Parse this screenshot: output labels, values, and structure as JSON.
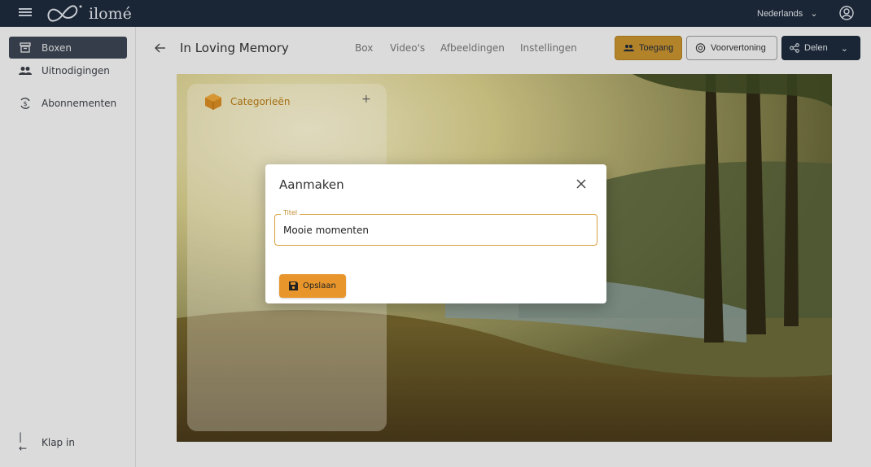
{
  "topbar": {
    "brand": "ilomé",
    "language": "Nederlands"
  },
  "sidebar": {
    "items": [
      {
        "label": "Boxen",
        "icon": "box-icon"
      },
      {
        "label": "Uitnodigingen",
        "icon": "people-icon"
      },
      {
        "label": "Abonnementen",
        "icon": "subscription-icon"
      }
    ],
    "collapse_label": "Klap in"
  },
  "header": {
    "title": "In Loving Memory",
    "tabs": [
      "Box",
      "Video's",
      "Afbeeldingen",
      "Instellingen"
    ],
    "buttons": {
      "access": "Toegang",
      "preview": "Voorvertoning",
      "share": "Delen"
    }
  },
  "categories": {
    "title": "Categorieën",
    "add": "+"
  },
  "modal": {
    "title": "Aanmaken",
    "field_label": "Titel",
    "field_value": "Mooie momenten",
    "save_label": "Opslaan"
  },
  "colors": {
    "topbar": "#1e2a3b",
    "accent": "#e8962c",
    "access_button": "#c8922f"
  }
}
